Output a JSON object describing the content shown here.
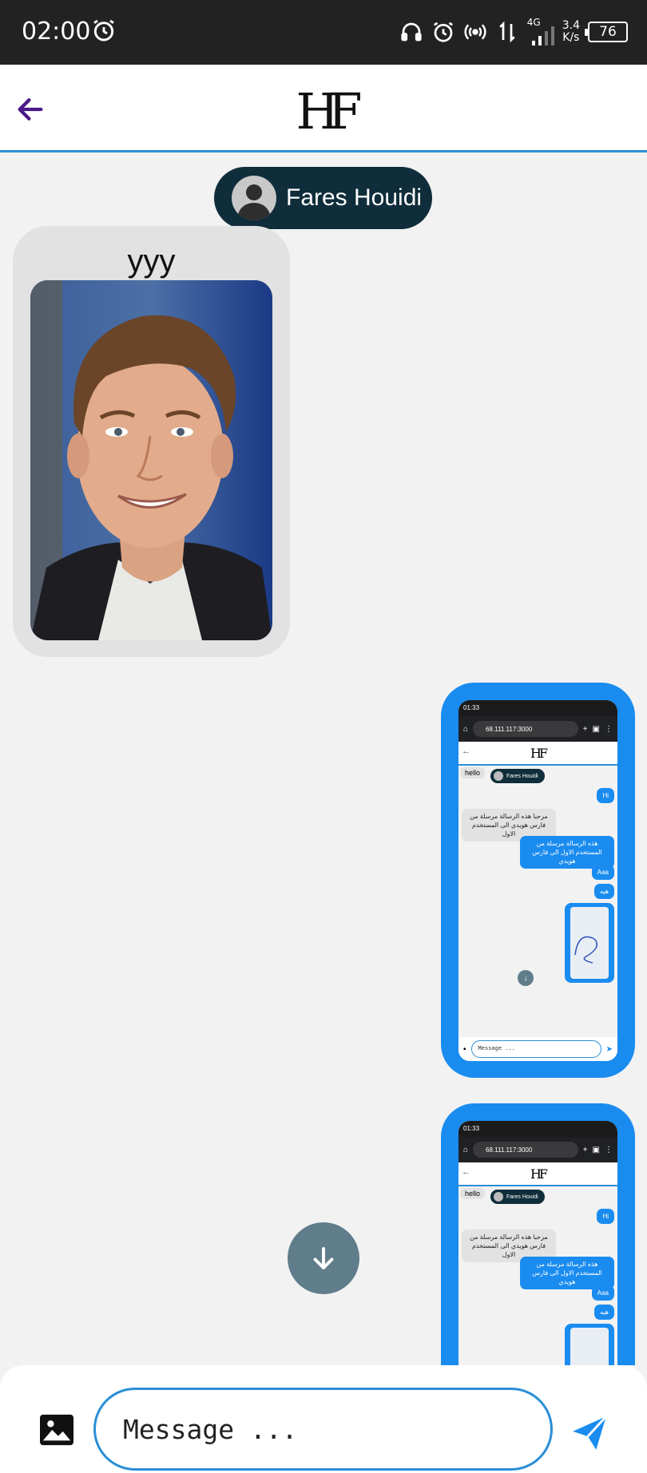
{
  "status_bar": {
    "time": "02:00",
    "network_label": "4G",
    "speed_value": "3.4",
    "speed_unit": "K/s",
    "battery": "76"
  },
  "header": {
    "logo": "HF",
    "back_icon": "arrow-left-icon"
  },
  "contact": {
    "name": "Fares Houidi",
    "avatar_icon": "user-avatar-icon"
  },
  "messages": [
    {
      "direction": "incoming",
      "text": "yyy",
      "has_image": true
    },
    {
      "direction": "outgoing",
      "type": "screenshot"
    },
    {
      "direction": "outgoing",
      "type": "screenshot"
    }
  ],
  "embedded_screenshot": {
    "time": "01:33",
    "url": "68.111.117:3000",
    "logo": "HF",
    "contact_name": "Fares Houidi",
    "msg_hello": "hello",
    "msg_hi": "Hi",
    "msg_arabic_in": "مرحبا هذه الرسالة مرسلة من فارس هويدي الى المستخدم الاول",
    "msg_arabic_out": "هذه الرسالة مرسلة من المستخدم الاول الى فارس هويدي",
    "msg_aaa": "Aaa",
    "msg_short": "هيه",
    "input_placeholder": "Message ..."
  },
  "composer": {
    "placeholder": "Message ...",
    "image_icon": "image-icon",
    "send_icon": "send-icon"
  },
  "colors": {
    "accent_blue": "#1a8cf0",
    "header_border": "#2a8fd6",
    "contact_pill": "#0f2d3a",
    "back_arrow": "#4b1a8a",
    "scroll_button": "#607d8b"
  }
}
